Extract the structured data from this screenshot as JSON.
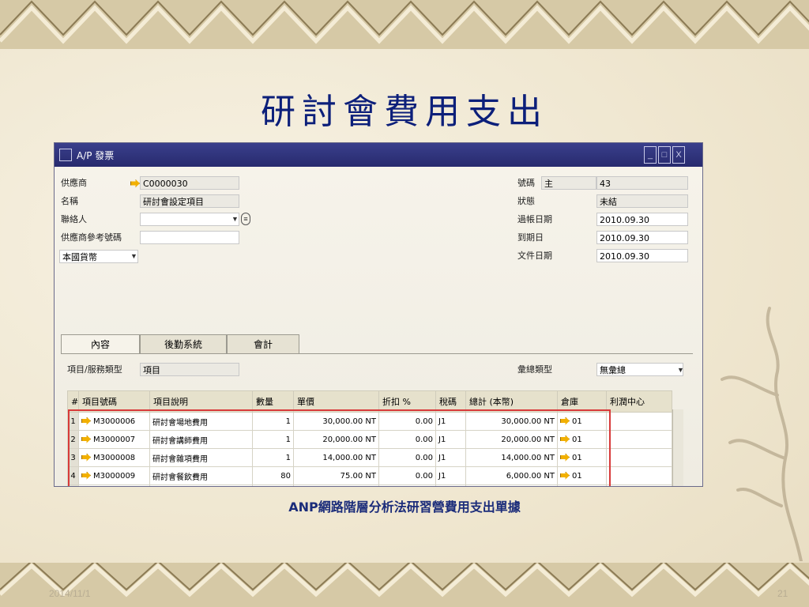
{
  "slide": {
    "title": "研討會費用支出",
    "caption": "ANP網路階層分析法研習營費用支出單據",
    "date": "2014/11/1",
    "page_number": "21"
  },
  "window": {
    "title": "A/P 發票",
    "controls": [
      "_",
      "□",
      "X"
    ]
  },
  "header_left": {
    "vendor_label": "供應商",
    "vendor_value": "C0000030",
    "name_label": "名稱",
    "name_value": "研討會設定項目",
    "contact_label": "聯絡人",
    "contact_value": "",
    "ref_label": "供應商參考號碼",
    "ref_value": "",
    "currency_value": "本國貨幣"
  },
  "header_right": {
    "number_label": "號碼",
    "number_series": "主",
    "number_value": "43",
    "status_label": "狀態",
    "status_value": "未結",
    "posting_label": "過帳日期",
    "posting_value": "2010.09.30",
    "due_label": "到期日",
    "due_value": "2010.09.30",
    "doc_label": "文件日期",
    "doc_value": "2010.09.30"
  },
  "tabs": [
    "內容",
    "後勤系統",
    "會計"
  ],
  "item_type": {
    "label": "項目/服務類型",
    "value": "項目"
  },
  "summary_type": {
    "label": "彙總類型",
    "value": "無彙總"
  },
  "table": {
    "headers": [
      "#",
      "項目號碼",
      "項目說明",
      "數量",
      "單價",
      "折扣 %",
      "稅碼",
      "總計 (本幣)",
      "倉庫",
      "利潤中心"
    ],
    "rows": [
      {
        "n": "1",
        "code": "M3000006",
        "desc": "研討會場地費用",
        "qty": "1",
        "price": "30,000.00 NT",
        "disc": "0.00",
        "tax": "J1",
        "total": "30,000.00 NT",
        "wh": "01",
        "pc": ""
      },
      {
        "n": "2",
        "code": "M3000007",
        "desc": "研討會講師費用",
        "qty": "1",
        "price": "20,000.00 NT",
        "disc": "0.00",
        "tax": "J1",
        "total": "20,000.00 NT",
        "wh": "01",
        "pc": ""
      },
      {
        "n": "3",
        "code": "M3000008",
        "desc": "研討會雜項費用",
        "qty": "1",
        "price": "14,000.00 NT",
        "disc": "0.00",
        "tax": "J1",
        "total": "14,000.00 NT",
        "wh": "01",
        "pc": ""
      },
      {
        "n": "4",
        "code": "M3000009",
        "desc": "研討會餐飲費用",
        "qty": "80",
        "price": "75.00 NT",
        "disc": "0.00",
        "tax": "J1",
        "total": "6,000.00 NT",
        "wh": "01",
        "pc": ""
      }
    ]
  }
}
